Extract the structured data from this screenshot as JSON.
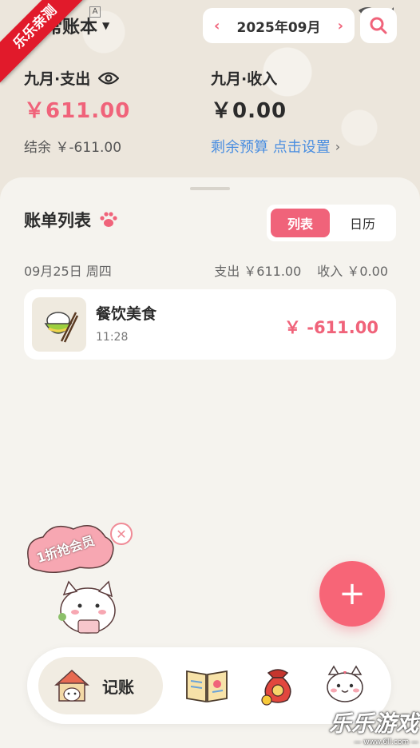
{
  "watermark": {
    "ribbon": "乐乐亲测",
    "site_name": "乐乐游戏",
    "site_url": "— www.6ll.com —"
  },
  "status_bar": {
    "indicator": "A"
  },
  "header": {
    "book_title": "常账本",
    "date_label": "2025年09月"
  },
  "summary": {
    "expense_label": "九月·支出",
    "expense_amount": "￥611.00",
    "income_label": "九月·收入",
    "income_amount": "￥0.00",
    "balance": "结余 ￥-611.00",
    "budget_link": "剩余预算 点击设置"
  },
  "list": {
    "title": "账单列表",
    "view_options": [
      "列表",
      "日历"
    ],
    "active_view": "列表",
    "days": [
      {
        "date": "09月25日 周四",
        "expense_total": "支出 ￥611.00",
        "income_total": "收入 ￥0.00",
        "records": [
          {
            "category": "餐饮美食",
            "time": "11:28",
            "amount": "￥ -611.00",
            "icon": "rice-bowl-icon"
          }
        ]
      }
    ]
  },
  "promo": {
    "text": "1折抢会员"
  },
  "tabbar": {
    "items": [
      {
        "label": "记账",
        "icon": "house-cat-icon"
      },
      {
        "label": "",
        "icon": "book-icon"
      },
      {
        "label": "",
        "icon": "money-bag-icon"
      },
      {
        "label": "",
        "icon": "cat-face-icon"
      }
    ]
  },
  "colors": {
    "accent": "#f0637a",
    "link": "#4a8ee0",
    "background": "#efebe3"
  }
}
